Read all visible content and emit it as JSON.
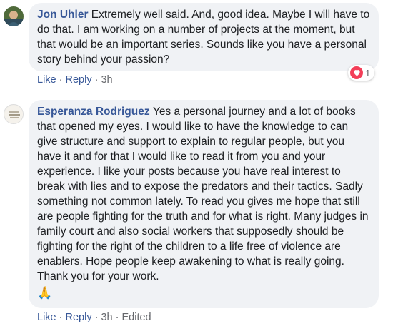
{
  "comments": [
    {
      "author": "Jon Uhler",
      "text": "Extremely well said. And, good idea. Maybe I will have to do that. I am working on a number of projects at the moment, but that would be an important series. Sounds like you have a personal story behind your passion?",
      "actions": {
        "like": "Like",
        "reply": "Reply",
        "time": "3h"
      },
      "reaction": {
        "type": "heart-icon",
        "count": "1"
      }
    },
    {
      "author": "Esperanza Rodriguez",
      "text": "Yes a personal journey and a lot of books that opened my eyes. I would like to have the knowledge to can give structure and support to explain to regular people, but you have it and for that I would like to read it from you and your experience. I like your posts because you have real interest to break with lies and to expose the predators and their tactics. Sadly something not common lately. To read you gives me hope that still are people fighting for the truth and for what is right. Many judges in family court and also social workers that supposedly should be fighting for the right of the children to a life free of violence are enablers. Hope people keep awakening to what is really going. Thank you for your work.",
      "emoji": "🙏",
      "actions": {
        "like": "Like",
        "reply": "Reply",
        "time": "3h",
        "edited": "Edited"
      }
    }
  ],
  "separator": "·",
  "colors": {
    "author": "#385898",
    "bubble": "#f0f2f5",
    "meta": "#65676b",
    "heart": "#f33e58"
  }
}
